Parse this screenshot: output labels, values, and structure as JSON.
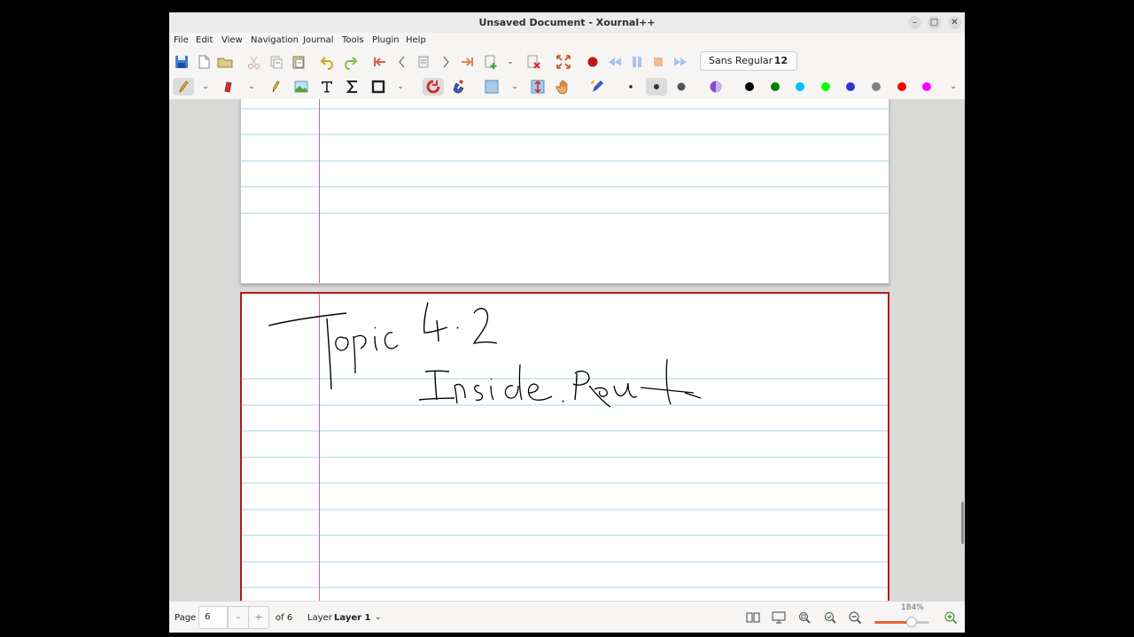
{
  "window": {
    "title": "Unsaved Document - Xournal++",
    "controls": {
      "minimize": "–",
      "maximize": "□",
      "close": "✕"
    }
  },
  "menu": [
    "File",
    "Edit",
    "View",
    "Navigation",
    "Journal",
    "Tools",
    "Plugin",
    "Help"
  ],
  "toolbar": {
    "font_name": "Sans Regular",
    "font_size": "12"
  },
  "colors": {
    "pen_palette": [
      "#000000",
      "#008000",
      "#00c0ff",
      "#00ff00",
      "#3333cc",
      "#808080",
      "#ff0000",
      "#ff00ff"
    ],
    "ruling_line": "#a8d3e3",
    "margin_line": "#c66ba8",
    "current_page_border": "#b11a1a"
  },
  "status": {
    "page_label": "Page",
    "page_value": "6",
    "of_pages": "of 6",
    "layer_label": "Layer",
    "layer_value": "Layer 1",
    "zoom_label": "184%",
    "zoom_level": 0.68
  },
  "document": {
    "current_page": 6,
    "page_count": 6,
    "handwriting": [
      "Topic 4.2",
      "Inside Route"
    ]
  }
}
